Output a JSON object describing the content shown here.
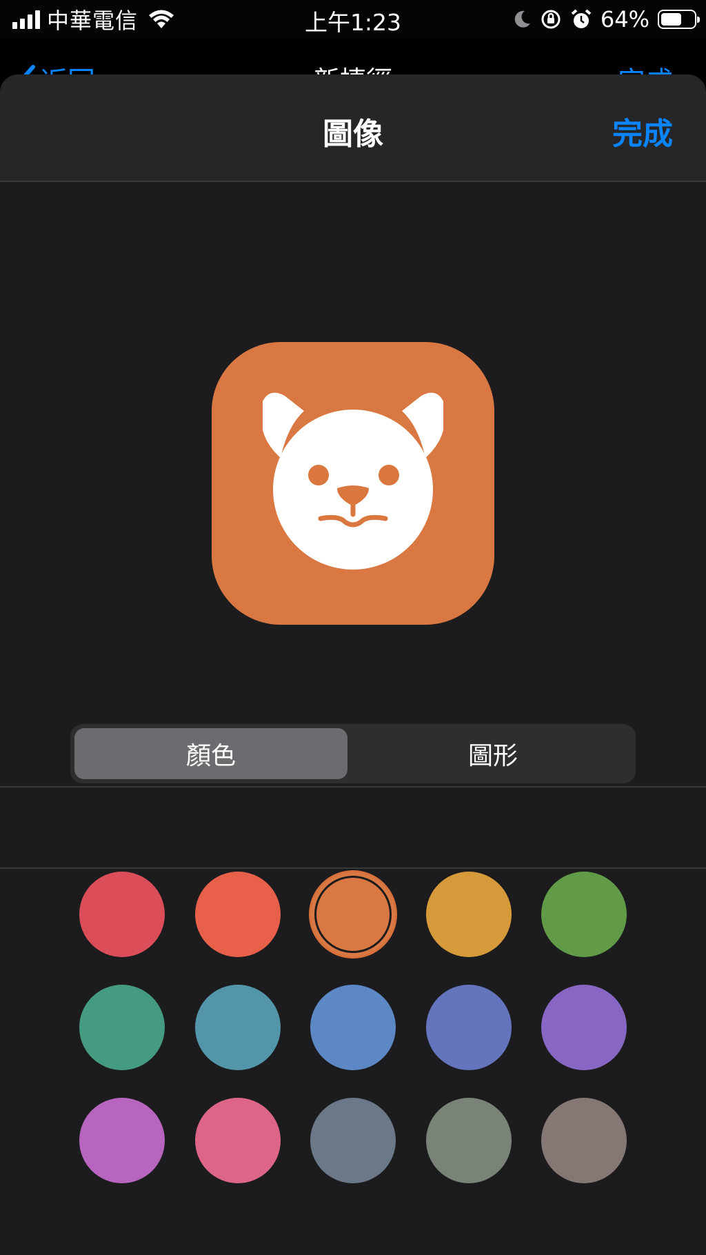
{
  "status_bar": {
    "carrier": "中華電信",
    "time": "上午1:23",
    "battery_percent": "64%",
    "battery_level": 0.64,
    "icons": [
      "signal-icon",
      "wifi-icon",
      "moon-icon",
      "rotation-lock-icon",
      "alarm-icon",
      "battery-icon"
    ]
  },
  "background_nav": {
    "back_label": "返回",
    "title": "新捷徑",
    "done_label": "完成"
  },
  "sheet": {
    "title": "圖像",
    "done_label": "完成"
  },
  "preview": {
    "glyph": "dog-face-icon",
    "color": "#d97843"
  },
  "segmented_control": {
    "tabs": [
      {
        "label": "顏色",
        "selected": true
      },
      {
        "label": "圖形",
        "selected": false
      }
    ]
  },
  "color_swatches": [
    {
      "color": "#db4d59",
      "selected": false
    },
    {
      "color": "#e8604a",
      "selected": false
    },
    {
      "color": "#d97843",
      "selected": true
    },
    {
      "color": "#d79a3b",
      "selected": false
    },
    {
      "color": "#619b48",
      "selected": false
    },
    {
      "color": "#459b82",
      "selected": false
    },
    {
      "color": "#5396a9",
      "selected": false
    },
    {
      "color": "#5c88c6",
      "selected": false
    },
    {
      "color": "#6474bd",
      "selected": false
    },
    {
      "color": "#8766c4",
      "selected": false
    },
    {
      "color": "#b865bf",
      "selected": false
    },
    {
      "color": "#dd6688",
      "selected": false
    },
    {
      "color": "#6b7888",
      "selected": false
    },
    {
      "color": "#7a8378",
      "selected": false
    },
    {
      "color": "#857774",
      "selected": false
    }
  ],
  "colors": {
    "accent": "#0a84ff",
    "sheet_bg": "#1c1c1e"
  }
}
